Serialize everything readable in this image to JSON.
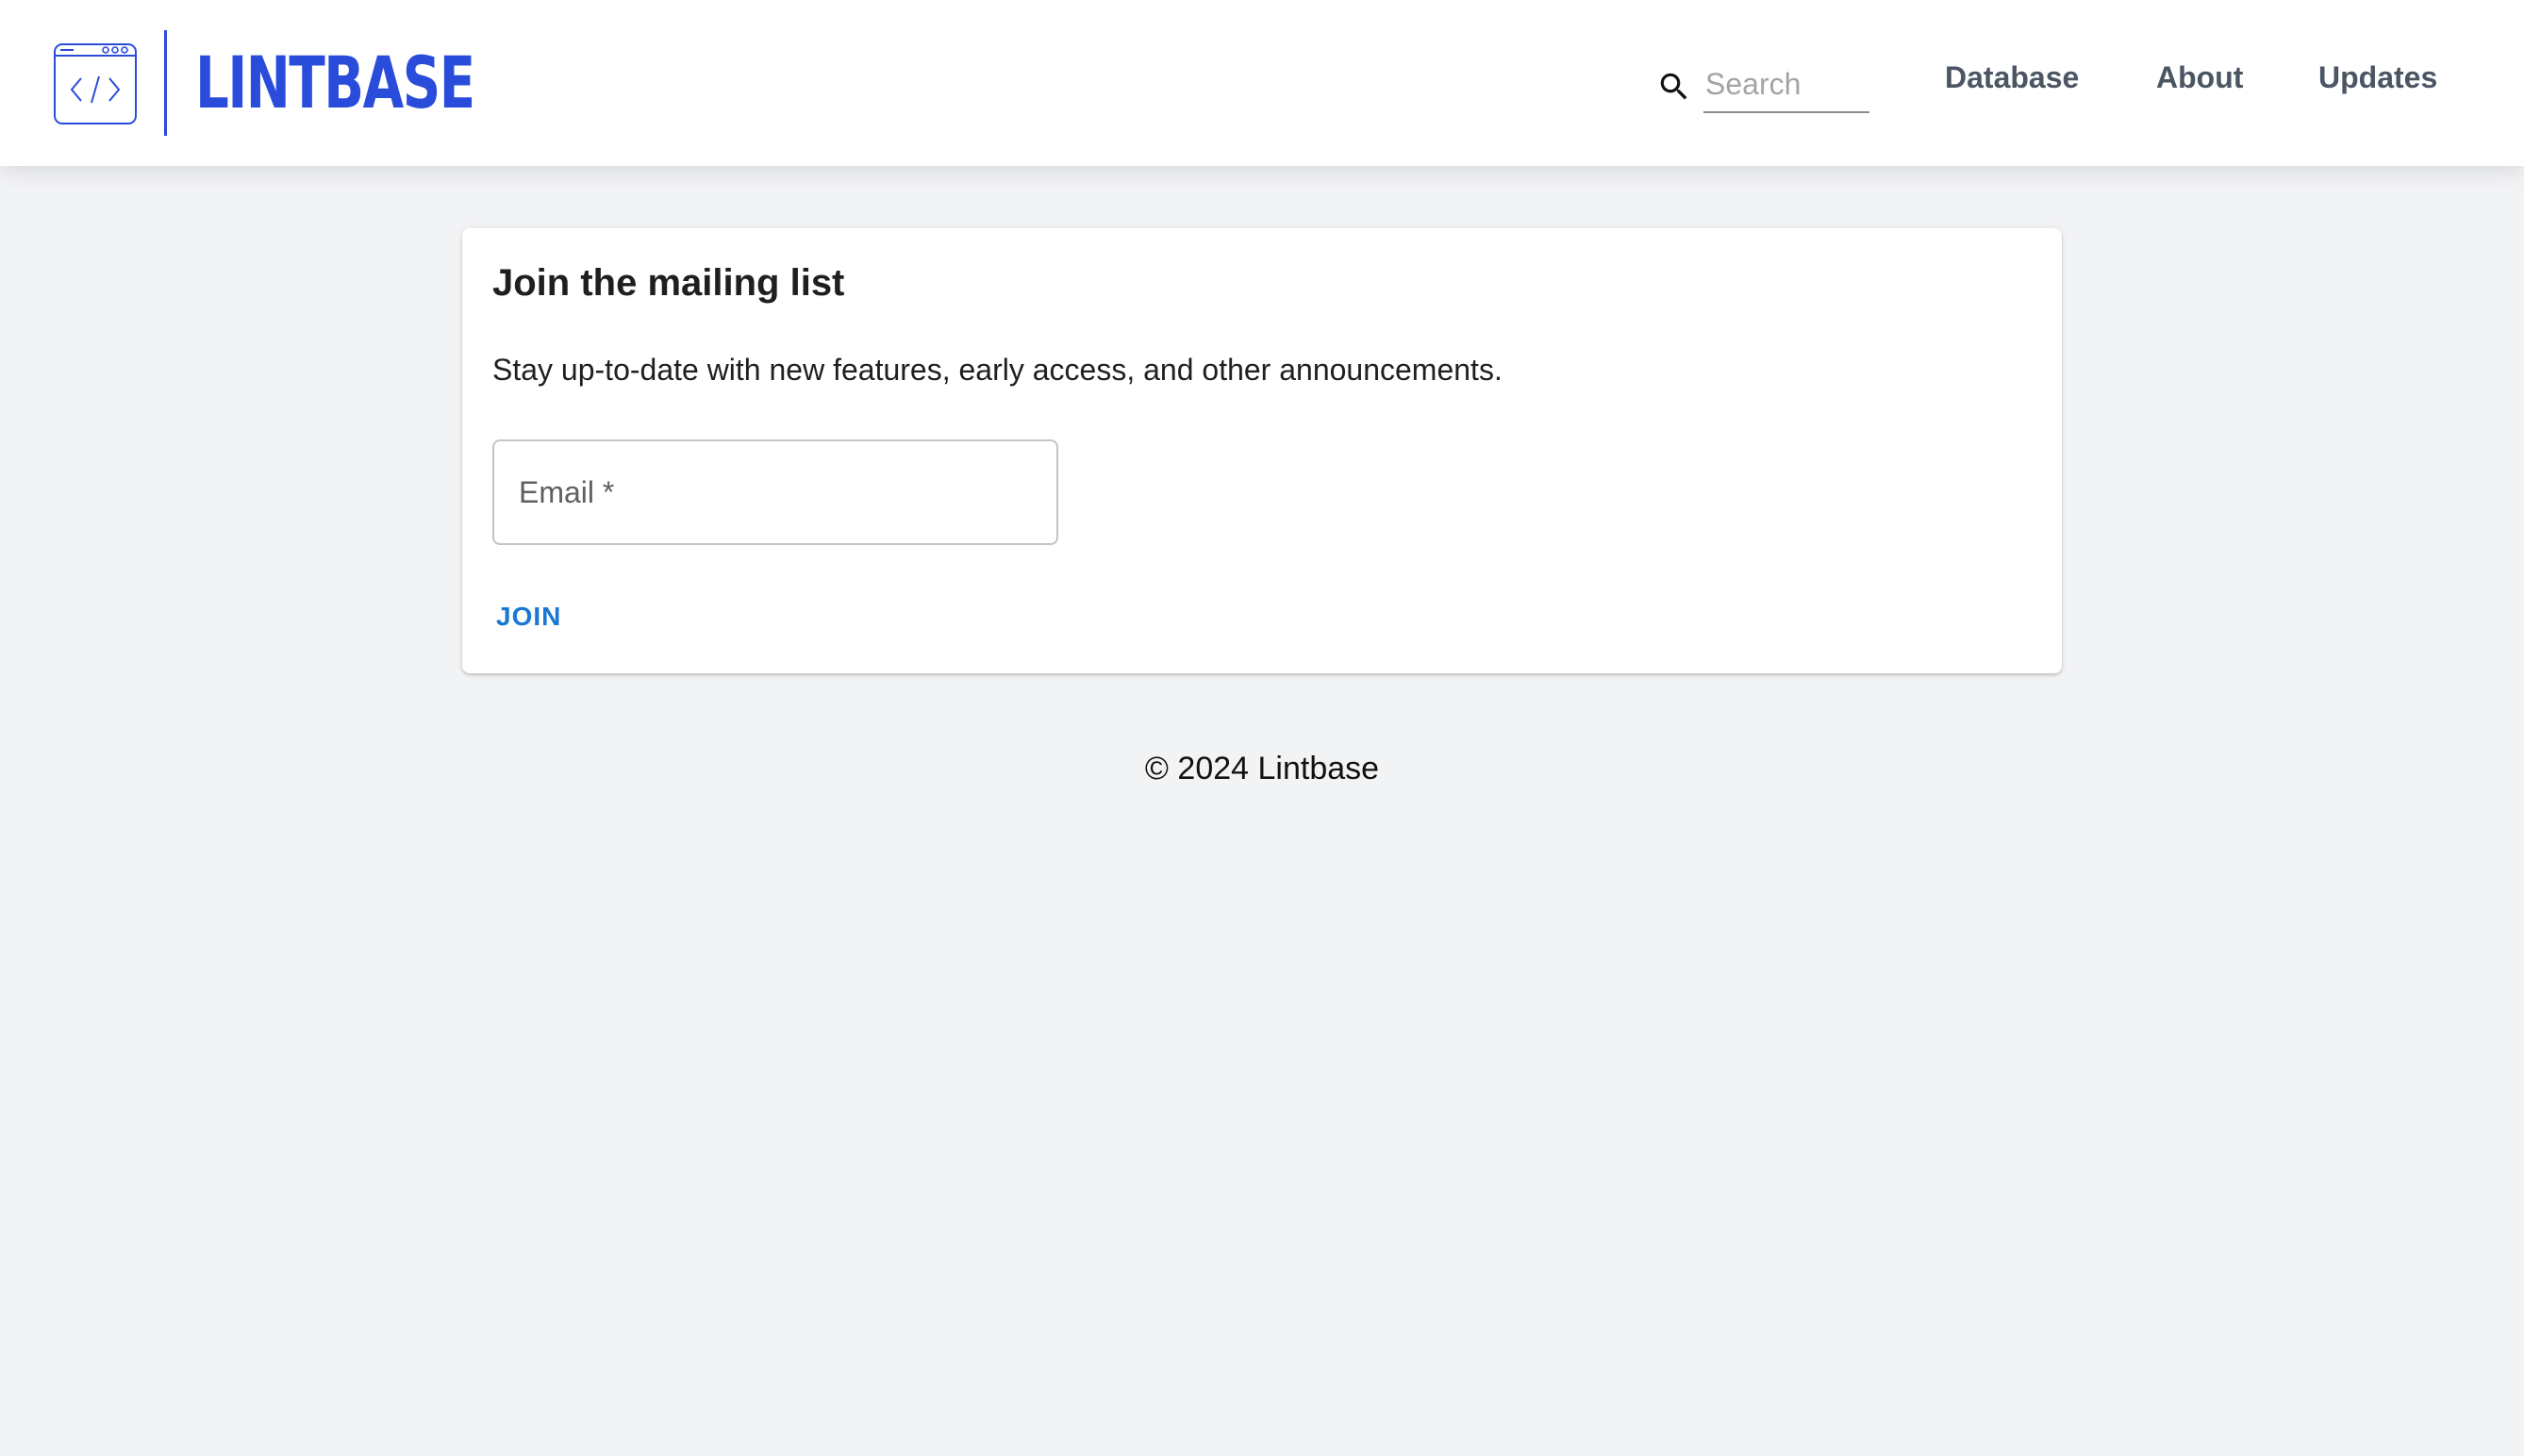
{
  "header": {
    "brand_name": "LINTBASE",
    "search": {
      "placeholder": "Search",
      "value": ""
    },
    "nav": [
      {
        "label": "Database"
      },
      {
        "label": "About"
      },
      {
        "label": "Updates"
      }
    ]
  },
  "mailing_list": {
    "title": "Join the mailing list",
    "description": "Stay up-to-date with new features, early access, and other announcements.",
    "email_label": "Email *",
    "email_value": "",
    "join_label": "JOIN"
  },
  "footer": {
    "copyright": "© 2024 Lintbase"
  },
  "colors": {
    "brand": "#2a4cdb",
    "link": "#1976d2",
    "nav_text": "#4b5563",
    "page_background": "#f2f3f5"
  },
  "icons": {
    "logo": "code-window-icon",
    "search": "search-icon"
  }
}
